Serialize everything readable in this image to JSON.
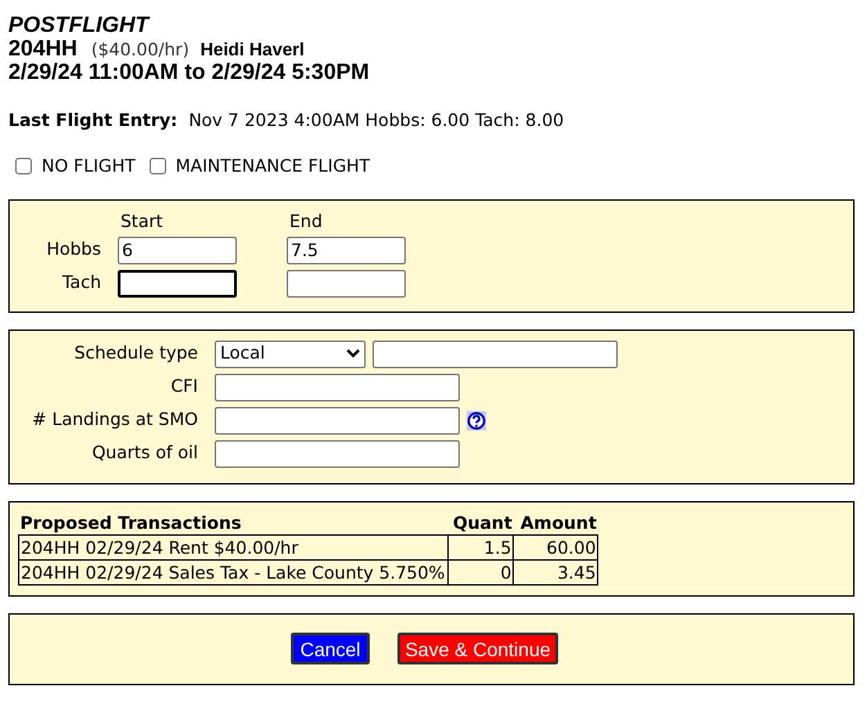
{
  "header": {
    "title": "POSTFLIGHT",
    "aircraft": "204HH",
    "rate": "($40.00/hr)",
    "pilot": "Heidi Haverl",
    "time_range": "2/29/24 11:00AM to 2/29/24 5:30PM"
  },
  "last_flight": {
    "label": "Last Flight Entry:",
    "value": "Nov 7 2023 4:00AM Hobbs: 6.00 Tach: 8.00"
  },
  "options": [
    {
      "label": "NO FLIGHT",
      "checked": false
    },
    {
      "label": "MAINTENANCE FLIGHT",
      "checked": false
    }
  ],
  "meters": {
    "columns": [
      "Start",
      "End"
    ],
    "rows": [
      {
        "label": "Hobbs",
        "start": {
          "value": "6",
          "focused": false
        },
        "end": {
          "value": "7.5",
          "focused": false
        }
      },
      {
        "label": "Tach",
        "start": {
          "focused": true
        },
        "end": {
          "focused": false
        }
      }
    ]
  },
  "details": [
    {
      "kind": "select",
      "label": "Schedule type",
      "value": "Local"
    },
    {
      "kind": "text",
      "label": "CFI"
    },
    {
      "kind": "help",
      "label": "# Landings at SMO"
    },
    {
      "kind": "text",
      "label": "Quarts of oil"
    }
  ],
  "transactions": {
    "columns": [
      "Proposed Transactions",
      "Quant",
      "Amount"
    ],
    "rows": [
      [
        "204HH 02/29/24 Rent $40.00/hr",
        "1.5",
        "60.00"
      ],
      [
        "204HH 02/29/24 Sales Tax - Lake County 5.750%",
        "0",
        "3.45"
      ]
    ]
  },
  "buttons": [
    {
      "label": "Cancel",
      "kind": "cancel"
    },
    {
      "label": "Save & Continue",
      "kind": "save"
    }
  ]
}
